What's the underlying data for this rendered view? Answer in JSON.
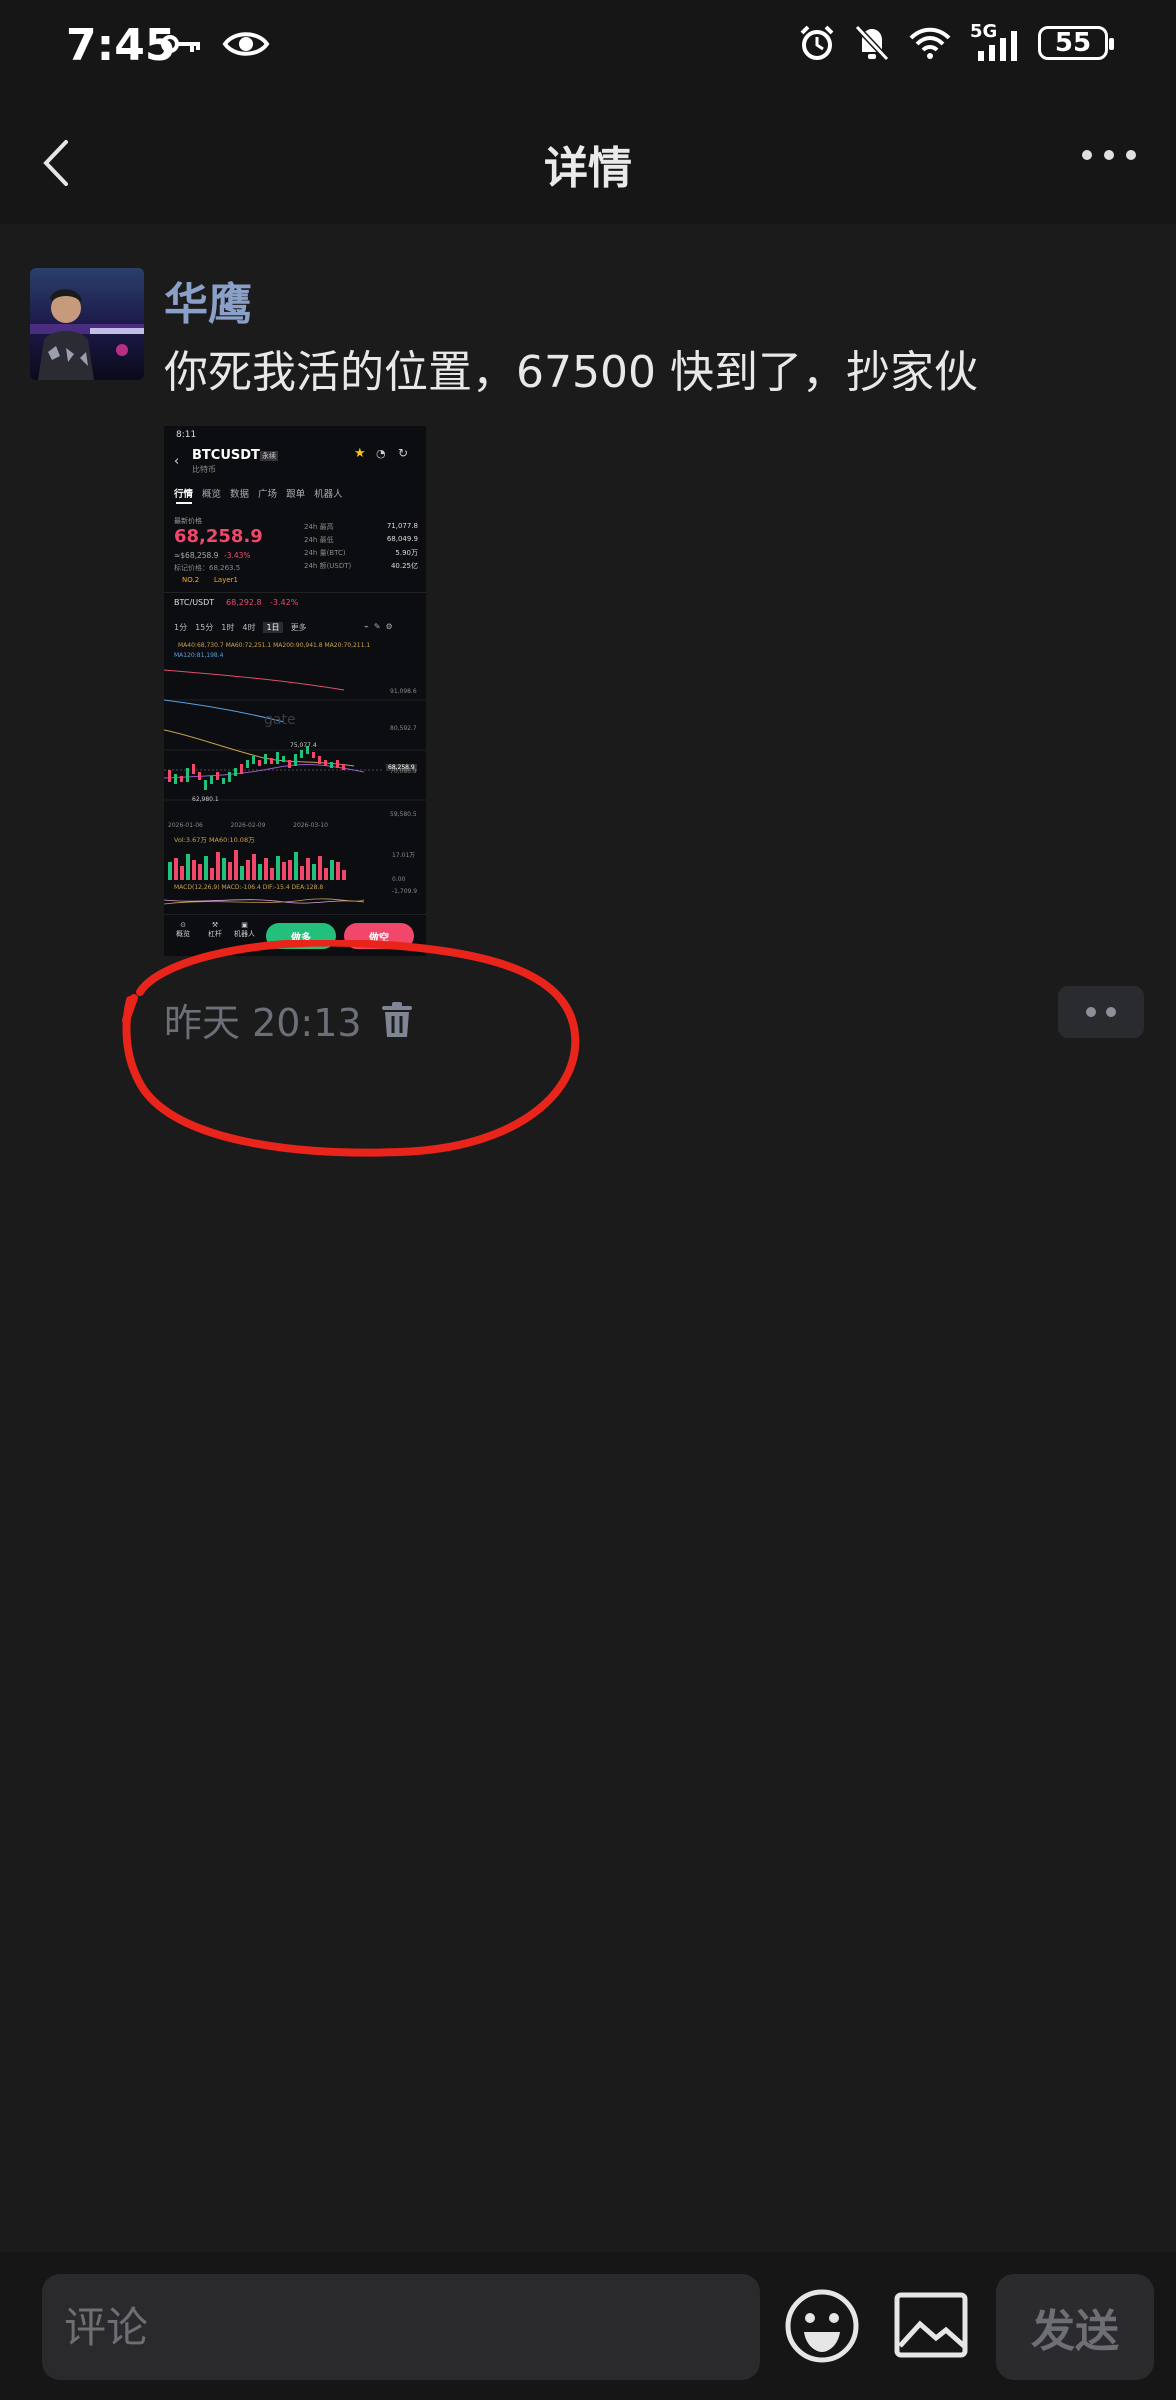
{
  "status_bar": {
    "time": "7:45",
    "network": "5G",
    "battery": "55"
  },
  "nav": {
    "title": "详情"
  },
  "post": {
    "author": "华鹰",
    "text": "你死我活的位置，67500 快到了，抄家伙",
    "time": "昨天 20:13"
  },
  "screenshot": {
    "status_time": "8:11",
    "pair": "BTCUSDT",
    "perp_tag": "永续",
    "coin_name": "比特币",
    "tabs": [
      "行情",
      "概览",
      "数据",
      "广场",
      "跟单",
      "机器人"
    ],
    "last_price_label": "最新价格",
    "price": "68,258.9",
    "price_sub": "≈$68,258.9",
    "change": "-3.43%",
    "mark_price_label": "标记价格：68,263.5",
    "rank": "NO.2",
    "layer_tag": "Layer1",
    "stats": [
      {
        "label": "24h 最高",
        "value": "71,077.8"
      },
      {
        "label": "24h 最低",
        "value": "68,049.9"
      },
      {
        "label": "24h 量(BTC)",
        "value": "5.90万"
      },
      {
        "label": "24h 额(USDT)",
        "value": "40.25亿"
      }
    ],
    "spot_pair": "BTC/USDT",
    "spot_price": "68,292.8",
    "spot_change": "-3.42%",
    "timeframes": [
      "1分",
      "15分",
      "1时",
      "4时",
      "1日",
      "更多"
    ],
    "ma_line1": "MA40:68,730.7   MA60:72,251.1   MA200:90,941.8   MA20:70,211.1",
    "ma_line2": "MA120:81,198.4",
    "watermark": "gate",
    "high_marker": "75,077.4",
    "low_marker": "62,980.1",
    "price_tag": "68,258.9",
    "right_axis": [
      "91,098.6",
      "80,592.7",
      "70,086.9",
      "59,580.5"
    ],
    "dates": [
      "2026-01-06",
      "2026-02-09",
      "2026-03-10"
    ],
    "vol_label": "Vol:3.67万   MA60:10.08万",
    "vol_axis": [
      "17.01万",
      "0.00"
    ],
    "macd_label": "MACD(12,26,9)  MACD:-106.4  DIF:-15.4  DEA:128.8",
    "macd_axis": [
      "-1,709.9"
    ],
    "bottom": {
      "nav1": "概览",
      "nav2": "杠杆",
      "nav3": "机器人",
      "long": "做多",
      "short": "做空"
    }
  },
  "bottom": {
    "comment_placeholder": "评论",
    "send": "发送"
  },
  "colors": {
    "background": "#1b1b1c",
    "author": "#8aa0c8",
    "annotation": "#e8241b",
    "buy": "#22c07a",
    "sell": "#f0476b"
  }
}
